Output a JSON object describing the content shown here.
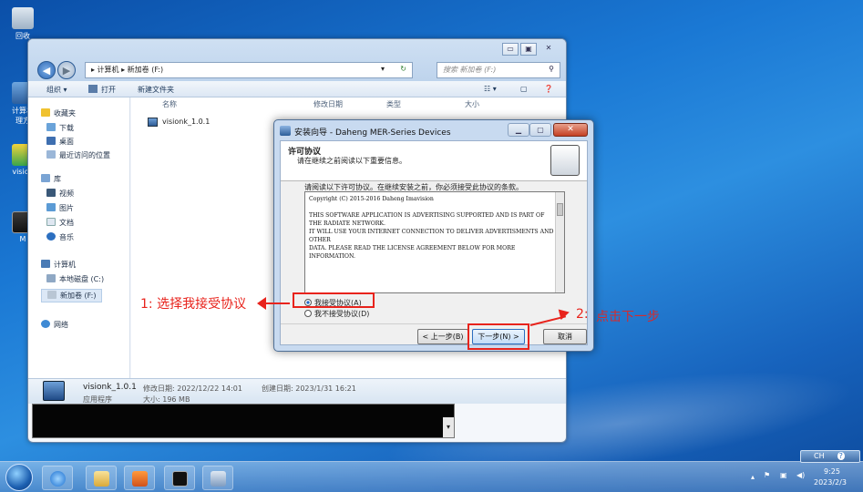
{
  "desktop": {
    "icons": [
      {
        "label": "回收"
      },
      {
        "label": "计算机\n理方"
      },
      {
        "label": "vision"
      },
      {
        "label": "M"
      }
    ]
  },
  "explorer": {
    "controls": {
      "minimize": "▭",
      "maximize": "▣",
      "close": "✕"
    },
    "address": "▸ 计算机 ▸ 新加卷 (F:)",
    "search_placeholder": "搜索 新加卷 (F:)",
    "toolbar": {
      "organize": "组织 ▾",
      "open": "打开",
      "new_folder": "新建文件夹"
    },
    "nav": {
      "favorites": "收藏夹",
      "downloads": "下载",
      "desktop": "桌面",
      "recent": "最近访问的位置",
      "libraries": "库",
      "videos": "视频",
      "pictures": "图片",
      "documents": "文档",
      "music": "音乐",
      "computer": "计算机",
      "local_disk": "本地磁盘 (C:)",
      "new_volume": "新加卷 (F:)",
      "network": "网络"
    },
    "columns": {
      "name": "名称",
      "modified": "修改日期",
      "type": "类型",
      "size": "大小"
    },
    "file": {
      "name": "visionk_1.0.1"
    },
    "details": {
      "name": "visionk_1.0.1",
      "modified": "修改日期: 2022/12/22 14:01",
      "created": "创建日期: 2023/1/31 16:21",
      "type": "应用程序",
      "size": "大小: 196 MB"
    }
  },
  "dialog": {
    "title": "安装向导 - Daheng MER-Series Devices",
    "header_title": "许可协议",
    "header_sub": "请在继续之前阅读以下重要信息。",
    "instruction": "请阅读以下许可协议。在继续安装之前，你必须接受此协议的条款。",
    "license_lines": [
      "Copyright (C) 2015-2016 Daheng Imavision",
      "",
      "THIS SOFTWARE APPLICATION IS ADVERTISING SUPPORTED AND IS PART OF",
      "THE RADIATE NETWORK.",
      "IT WILL USE YOUR INTERNET CONNECTION TO DELIVER ADVERTISMENTS AND",
      "OTHER",
      "DATA.  PLEASE READ THE LICENSE AGREEMENT BELOW FOR MORE",
      "INFORMATION."
    ],
    "accept": "我接受协议(A)",
    "decline": "我不接受协议(D)",
    "back": "< 上一步(B)",
    "next": "下一步(N) >",
    "cancel": "取消"
  },
  "annotations": {
    "step1": "1: 选择我接受协议",
    "step2_num": "2:",
    "step2_text": "点击下一步"
  },
  "taskbar": {
    "lang": "CH",
    "time": "9:25",
    "date": "2023/2/3"
  },
  "colors": {
    "annotation_red": "#e8231c",
    "desktop_blue": "#1a78d4"
  }
}
